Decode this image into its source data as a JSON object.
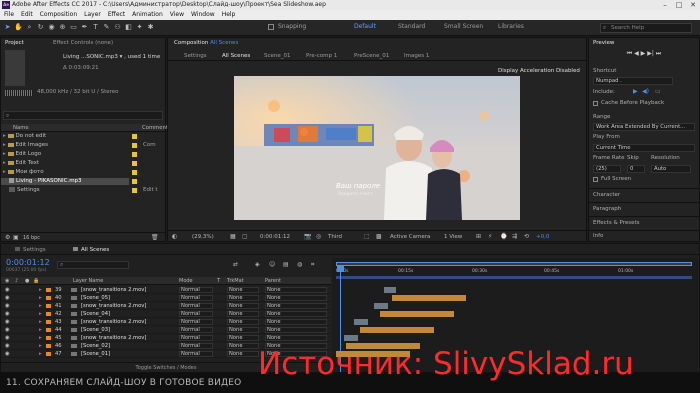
{
  "window": {
    "title": "Adobe After Effects CC 2017 - C:\\Users\\Администратор\\Desktop\\Слайд-шоу\\Проект\\Sea Slideshow.aep"
  },
  "menu": [
    "File",
    "Edit",
    "Composition",
    "Layer",
    "Effect",
    "Animation",
    "View",
    "Window",
    "Help"
  ],
  "toolbar": {
    "snapping_label": "Snapping",
    "workspaces": [
      "Default",
      "Standard",
      "Small Screen",
      "Libraries"
    ],
    "active_workspace": "Default",
    "search_placeholder": "Search Help"
  },
  "project_panel": {
    "tab_label": "Project",
    "effect_controls_label": "Effect Controls (none)",
    "file_name": "Living ...SONIC.mp3 ▾ , used 1 time",
    "duration": "Δ 0:03:09:21",
    "audio_info": "48,000 kHz / 32 bit U / Stereo",
    "columns": {
      "name": "Name",
      "comment": "Comment"
    },
    "items": [
      {
        "name": "Do not edit",
        "comment": ""
      },
      {
        "name": "Edit Images",
        "comment": "Com"
      },
      {
        "name": "Edit Logo",
        "comment": ""
      },
      {
        "name": "Edit Text",
        "comment": ""
      },
      {
        "name": "Мои фото",
        "comment": ""
      },
      {
        "name": "Living - PIKASONIC.mp3",
        "comment": ""
      },
      {
        "name": "Settings",
        "comment": "Edit t"
      }
    ],
    "bpc": "16 bpc"
  },
  "composition": {
    "tab_label": "Composition",
    "tab_name": "All Scenes",
    "tabs": [
      "Settings",
      "All Scenes",
      "Scene_01",
      "Pre-comp 1",
      "PreScene_01",
      "Images 1"
    ],
    "active_tab": "All Scenes",
    "notice": "Display Acceleration Disabled",
    "preview_text_1": "Ваш пароле",
    "preview_text_2": "Введите текст",
    "zoom": "(29,3%)",
    "timecode": "0:00:01:12",
    "resolution": "Third",
    "camera": "Active Camera",
    "views": "1 View",
    "exposure": "+0,0"
  },
  "preview_panel": {
    "title": "Preview",
    "shortcut_label": "Shortcut",
    "shortcut_value": "Numpad .",
    "include_label": "Include:",
    "cache_label": "Cache Before Playback",
    "range_label": "Range",
    "range_value": "Work Area Extended By Current...",
    "play_from_label": "Play From",
    "play_from_value": "Current Time",
    "frame_rate_label": "Frame Rate",
    "skip_label": "Skip",
    "resolution_label": "Resolution",
    "frame_rate_value": "(25)",
    "skip_value": "0",
    "resolution_value": "Auto",
    "full_screen_label": "Full Screen",
    "sections": [
      "Character",
      "Paragraph",
      "Effects & Presets",
      "Info"
    ]
  },
  "timeline": {
    "tabs": [
      "Settings",
      "All Scenes"
    ],
    "active_tab": "All Scenes",
    "timecode": "0:00:01:12",
    "fps_info": "00037 (25.00 fps)",
    "columns": {
      "layer_name": "Layer Name",
      "mode": "Mode",
      "t": "T",
      "trkmat": "TrkMat",
      "parent": "Parent"
    },
    "ruler": [
      "0:00s",
      "00:15s",
      "00:30s",
      "00:45s",
      "01:00s"
    ],
    "layers": [
      {
        "num": "39",
        "name": "[snow_transitions 2.mov]",
        "mode": "Normal",
        "trk": "None",
        "parent": "None"
      },
      {
        "num": "40",
        "name": "[Scene_05]",
        "mode": "Normal",
        "trk": "None",
        "parent": "None"
      },
      {
        "num": "41",
        "name": "[snow_transitions 2.mov]",
        "mode": "Normal",
        "trk": "None",
        "parent": "None"
      },
      {
        "num": "42",
        "name": "[Scene_04]",
        "mode": "Normal",
        "trk": "None",
        "parent": "None"
      },
      {
        "num": "43",
        "name": "[snow_transitions 2.mov]",
        "mode": "Normal",
        "trk": "None",
        "parent": "None"
      },
      {
        "num": "44",
        "name": "[Scene_03]",
        "mode": "Normal",
        "trk": "None",
        "parent": "None"
      },
      {
        "num": "45",
        "name": "[snow_transitions 2.mov]",
        "mode": "Normal",
        "trk": "None",
        "parent": "None"
      },
      {
        "num": "46",
        "name": "[Scene_02]",
        "mode": "Normal",
        "trk": "None",
        "parent": "None"
      },
      {
        "num": "47",
        "name": "[Scene_01]",
        "mode": "Normal",
        "trk": "None",
        "parent": "None"
      }
    ],
    "toggle_label": "Toggle Switches / Modes"
  },
  "caption": "11. СОХРАНЯЕМ СЛАЙД-ШОУ В ГОТОВОЕ ВИДЕО",
  "watermark": "Источник: SlivySklad.ru",
  "colors": {
    "accent": "#4f8df0",
    "layer_label": "#e38a2e",
    "watermark": "#ff2a2a"
  }
}
